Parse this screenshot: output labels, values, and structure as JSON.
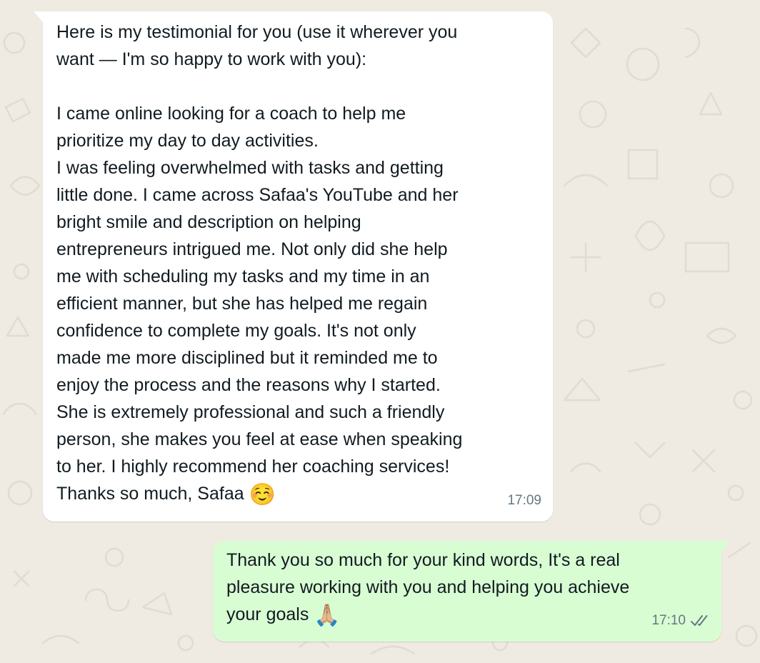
{
  "chat": {
    "incoming": {
      "text": "Here is my testimonial for you (use it wherever you\nwant — I'm so happy to work with you):\n\nI came online looking for a coach to help me\nprioritize my day to day activities.\nI was feeling overwhelmed with tasks and getting\nlittle done. I came across Safaa's YouTube and her\nbright smile and description on helping\nentrepreneurs intrigued me. Not only did she help\nme with scheduling my tasks and my time in an\nefficient manner, but she has helped me regain\nconfidence to complete my goals. It's not only\nmade me more disciplined but it reminded me to\nenjoy the process and the reasons why I started.\nShe is extremely professional and such a friendly\nperson, she makes you feel at ease when speaking\nto her. I highly recommend her coaching services!\nThanks so much, Safaa ",
      "emoji": "☺️",
      "time": "17:09"
    },
    "outgoing": {
      "text": "Thank you so much for your kind words, It's a real\npleasure working with you and helping you achieve\nyour goals ",
      "emoji": "🙏🏼",
      "time": "17:10",
      "status_icon": "double-check-icon"
    }
  },
  "colors": {
    "wallpaper": "#efeae2",
    "incoming_bubble": "#ffffff",
    "outgoing_bubble": "#d9fdd3",
    "meta_text": "#667781"
  }
}
